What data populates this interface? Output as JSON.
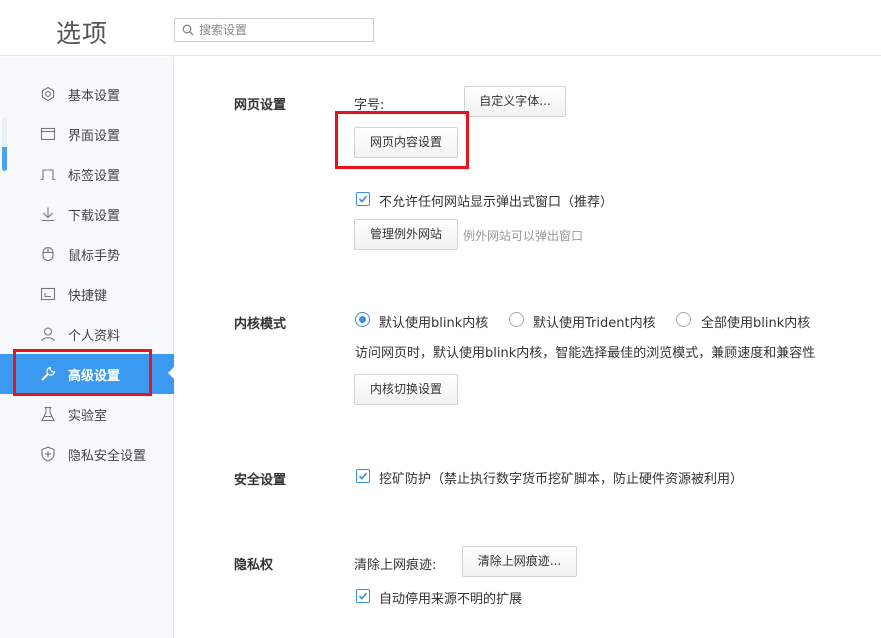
{
  "header": {
    "title": "选项",
    "search_placeholder": "搜索设置"
  },
  "sidebar": {
    "items": [
      {
        "label": "基本设置",
        "icon": "gear-icon"
      },
      {
        "label": "界面设置",
        "icon": "window-icon"
      },
      {
        "label": "标签设置",
        "icon": "tab-icon"
      },
      {
        "label": "下载设置",
        "icon": "download-icon"
      },
      {
        "label": "鼠标手势",
        "icon": "mouse-icon"
      },
      {
        "label": "快捷键",
        "icon": "keyboard-icon"
      },
      {
        "label": "个人资料",
        "icon": "user-icon"
      },
      {
        "label": "高级设置",
        "icon": "wrench-icon",
        "active": true
      },
      {
        "label": "实验室",
        "icon": "flask-icon"
      },
      {
        "label": "隐私安全设置",
        "icon": "shield-icon"
      }
    ]
  },
  "webpage": {
    "title": "网页设置",
    "font_size_label": "字号:",
    "custom_font_button": "自定义字体...",
    "content_settings_button": "网页内容设置",
    "block_popups_label": "不允许任何网站显示弹出式窗口（推荐）",
    "block_popups_checked": true,
    "manage_exceptions_button": "管理例外网站",
    "exceptions_hint": "例外网站可以弹出窗口"
  },
  "kernel": {
    "title": "内核模式",
    "options": [
      {
        "label": "默认使用blink内核",
        "checked": true
      },
      {
        "label": "默认使用Trident内核",
        "checked": false
      },
      {
        "label": "全部使用blink内核",
        "checked": false
      }
    ],
    "description": "访问网页时，默认使用blink内核，智能选择最佳的浏览模式，兼顾速度和兼容性",
    "switch_button": "内核切换设置"
  },
  "security": {
    "title": "安全设置",
    "mining_label": "挖矿防护（禁止执行数字货币挖矿脚本，防止硬件资源被利用）",
    "mining_checked": true
  },
  "privacy": {
    "title": "隐私权",
    "clear_label": "清除上网痕迹:",
    "clear_button": "清除上网痕迹...",
    "disable_ext_label": "自动停用来源不明的扩展",
    "disable_ext_checked": true
  },
  "colors": {
    "accent": "#3b99f0",
    "highlight": "#e8141c"
  }
}
